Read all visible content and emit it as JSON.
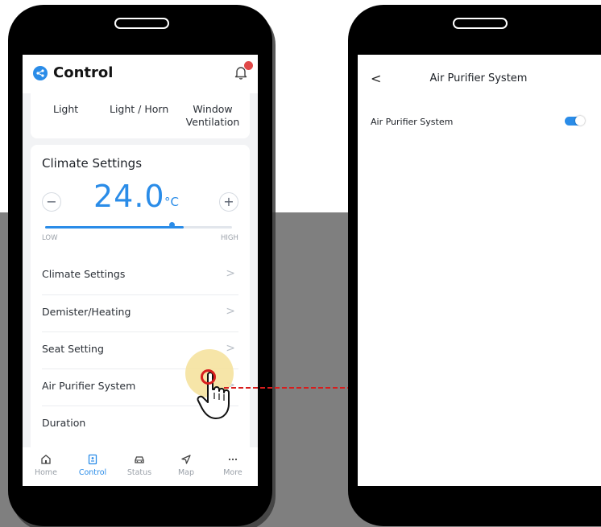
{
  "left_phone": {
    "header": {
      "title": "Control",
      "notification_count": ""
    },
    "shortcuts": [
      {
        "label": "Light"
      },
      {
        "label": "Light / Horn"
      },
      {
        "label": "Window Ventilation"
      }
    ],
    "climate": {
      "title": "Climate Settings",
      "minus_label": "−",
      "plus_label": "+",
      "temperature": "24.0",
      "unit": "°C",
      "slider_level_fraction": 0.74,
      "low_label": "LOW",
      "high_label": "HIGH"
    },
    "rows": [
      {
        "label": "Climate Settings"
      },
      {
        "label": "Demister/Heating"
      },
      {
        "label": "Seat Setting"
      },
      {
        "label": "Air Purifier System"
      },
      {
        "label": "Duration"
      }
    ],
    "chevron": ">",
    "tabs": [
      {
        "label": "Home",
        "icon": "home-icon",
        "active": false
      },
      {
        "label": "Control",
        "icon": "control-icon",
        "active": true
      },
      {
        "label": "Status",
        "icon": "car-icon",
        "active": false
      },
      {
        "label": "Map",
        "icon": "navigation-icon",
        "active": false
      },
      {
        "label": "More",
        "icon": "more-icon",
        "active": false
      }
    ]
  },
  "right_phone": {
    "back_label": "<",
    "title": "Air Purifier System",
    "setting_label": "Air Purifier System",
    "toggle_on": true
  },
  "colors": {
    "accent": "#2a8ce8",
    "highlight": "#f5e3a1",
    "arrow": "#d81d1d",
    "backdrop": "#7f7f7f"
  }
}
